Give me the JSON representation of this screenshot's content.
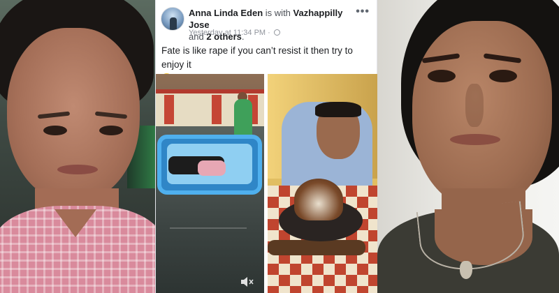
{
  "post": {
    "author": "Anna Linda Eden",
    "with_text": "is with",
    "tagged": "Vazhappilly Jose",
    "and_text": "and",
    "others": "2 others",
    "period": ".",
    "timestamp": "Yesterday at 11:34 PM",
    "separator": "·",
    "message": "Fate is like rape if you can’t resist it then try to enjoy it",
    "more_icon": "•••"
  },
  "icons": {
    "privacy": "globe-icon",
    "options": "more-options-icon",
    "emoji": "tongue-wink-emoji-icon",
    "video": "mute-icon"
  }
}
